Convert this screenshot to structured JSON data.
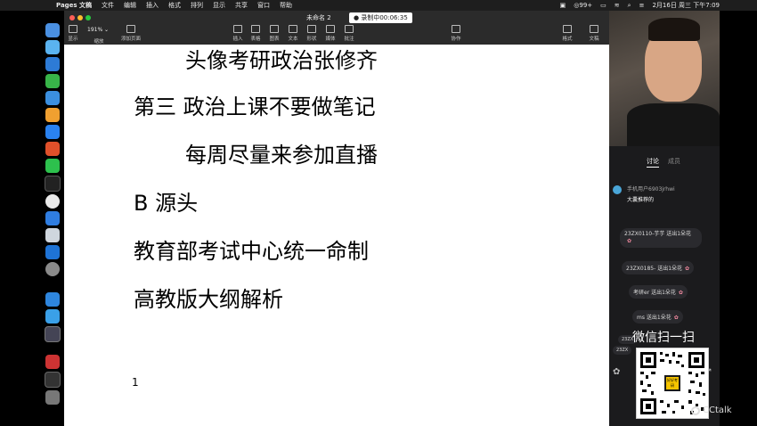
{
  "menubar": {
    "app_name": "Pages 文稿",
    "items": [
      "文件",
      "编辑",
      "插入",
      "格式",
      "排列",
      "显示",
      "共享",
      "窗口",
      "帮助"
    ],
    "status": "99+",
    "datetime": "2月16日 周三 下午7:09"
  },
  "window": {
    "title": "未命名 2",
    "recording": "● 录制中00:06:35",
    "zoom": "191% ⌄",
    "toolbar_left": [
      "显示",
      "缩放",
      "添加页面"
    ],
    "toolbar_center": [
      "插入",
      "表格",
      "图表",
      "文本",
      "形状",
      "媒体",
      "批注"
    ],
    "toolbar_collab": "协作",
    "toolbar_right": [
      "格式",
      "文稿"
    ]
  },
  "document": {
    "lines": [
      "头像考研政治张修齐",
      "第三 政治上课不要做笔记",
      "每周尽量来参加直播",
      "B 源头",
      "教育部考试中心统一命制",
      "高教版大纲解析"
    ],
    "page_number": "1"
  },
  "side_panel": {
    "tabs": [
      "讨论",
      "成员"
    ],
    "message": {
      "user": "手机用户6903jrhwi",
      "text": "大囊推荐的"
    },
    "gifts": [
      "23ZX0110-芋芋 送出1朵花",
      "23ZX0185- 送出1朵花",
      "考研er 送出1朵花",
      "ms 送出1朵花"
    ],
    "gift_prefix_partial": "23ZX",
    "qr_label": "微信扫一扫",
    "qr_center_text": "好好考研",
    "brand": "CCtalk"
  }
}
